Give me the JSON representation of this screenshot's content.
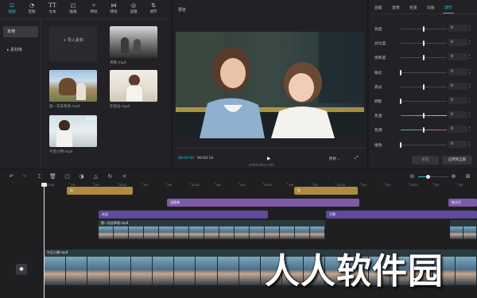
{
  "toolbar": {
    "items": [
      {
        "label": "视频",
        "icon": "video-icon"
      },
      {
        "label": "音频",
        "icon": "audio-icon"
      },
      {
        "label": "文本",
        "icon": "text-icon"
      },
      {
        "label": "贴纸",
        "icon": "sticker-icon"
      },
      {
        "label": "特效",
        "icon": "effects-icon"
      },
      {
        "label": "转场",
        "icon": "transition-icon"
      },
      {
        "label": "滤镜",
        "icon": "filter-icon"
      },
      {
        "label": "调节",
        "icon": "adjust-icon"
      }
    ],
    "active_index": 0
  },
  "media": {
    "nav": [
      {
        "label": "本地"
      },
      {
        "label": "▸ 素材库"
      }
    ],
    "import_label": "导入素材",
    "clips": [
      {
        "name": "青春.mp4",
        "duration": ""
      },
      {
        "name": "第一次去草原.mp4",
        "duration": ""
      },
      {
        "name": "在街边.mp4",
        "duration": ""
      },
      {
        "name": "午后小憩.mp4",
        "duration": "00:06"
      }
    ]
  },
  "preview": {
    "title": "预览",
    "time_current": "00:00:00",
    "time_total": "00:00:10",
    "play_icon": "▶",
    "ratio_label": "原始",
    "watermark_text": "www.kkx.net"
  },
  "adjust": {
    "tabs": [
      "画面",
      "音频",
      "变速",
      "动画",
      "调节"
    ],
    "active_tab": 4,
    "rows": [
      {
        "label": "亮度",
        "value": "0",
        "level": 0.5
      },
      {
        "label": "对比度",
        "value": "0",
        "level": 0.5
      },
      {
        "label": "饱和度",
        "value": "0",
        "level": 0.5
      },
      {
        "label": "锐化",
        "value": "0",
        "level": 0.0
      },
      {
        "label": "高光",
        "value": "0",
        "level": 0.5
      },
      {
        "label": "阴影",
        "value": "0",
        "level": 0.0
      },
      {
        "label": "色温",
        "value": "0",
        "level": 0.5
      },
      {
        "label": "色调",
        "value": "0",
        "level": 0.5
      },
      {
        "label": "褪色",
        "value": "0",
        "level": 0.0
      }
    ],
    "reset_label": "重置",
    "apply_all_label": "应用到全部"
  },
  "timeline": {
    "ruler": [
      "00:00",
      "10f",
      "20f",
      "00:01",
      "10f",
      "20f",
      "00:02",
      "10f",
      "20f",
      "00:03",
      "10f",
      "20f",
      "00:04",
      "10f",
      "20f",
      "00:05",
      "10f",
      "20f"
    ],
    "segments": {
      "sticker1": "贴",
      "sticker2": "贴",
      "effect1": "温暖感",
      "effect2": "聚光灯",
      "text1": "欢迎",
      "text2": "字幕",
      "video1_name": "第一次去草原.mp4",
      "main_track_name": "午后小憩.mp4"
    },
    "cover_icon": "●",
    "colors": {
      "sticker": "#b08a3e",
      "effect": "#7d5aa8",
      "text": "#5f4a9e",
      "video": "#2f6f73"
    }
  },
  "site_watermark": "人人软件园"
}
